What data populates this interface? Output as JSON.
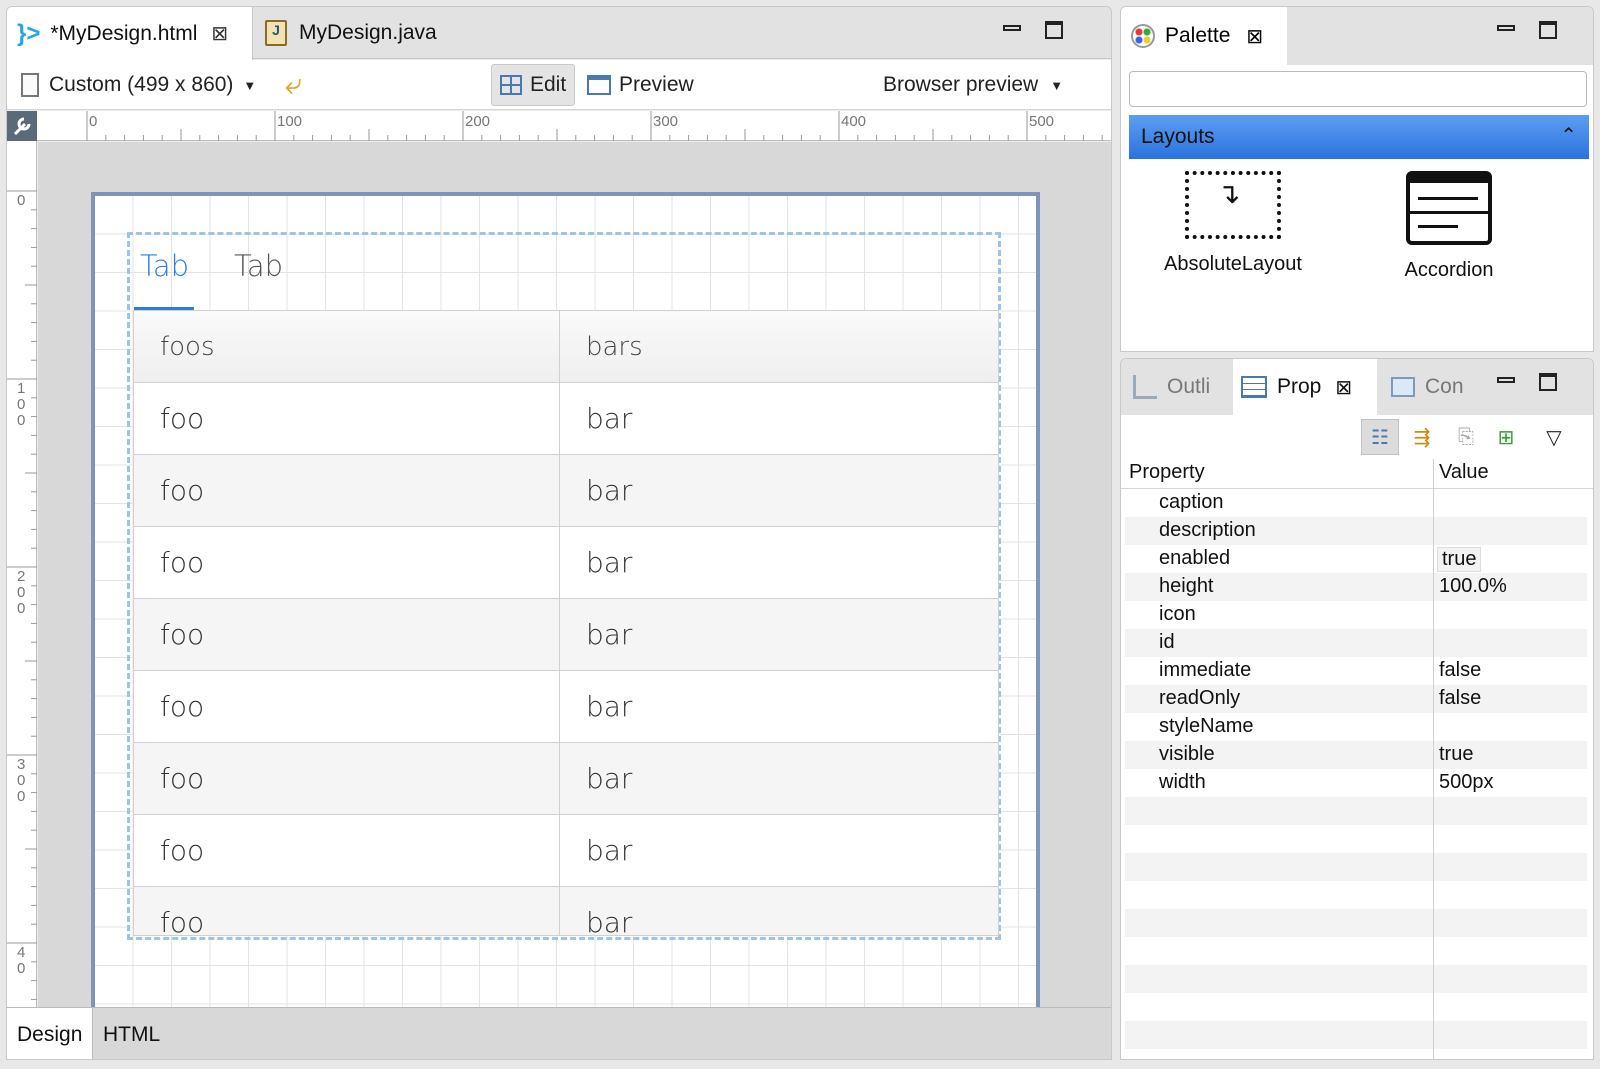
{
  "editor": {
    "tabs": [
      {
        "label": "*MyDesign.html",
        "active": true
      },
      {
        "label": "MyDesign.java",
        "active": false
      }
    ],
    "toolbar": {
      "size_select": "Custom (499 x 860)",
      "edit_label": "Edit",
      "preview_label": "Preview",
      "browser_preview": "Browser preview"
    },
    "ruler_h": [
      "0",
      "100",
      "200",
      "300",
      "400",
      "500"
    ],
    "ruler_v": [
      "0",
      "1\n0\n0",
      "2\n0\n0",
      "3\n0\n0",
      "4\n0"
    ],
    "design": {
      "tabs": [
        "Tab",
        "Tab"
      ],
      "grid_header": [
        "foos",
        "bars"
      ],
      "grid_rows": [
        [
          "foo",
          "bar"
        ],
        [
          "foo",
          "bar"
        ],
        [
          "foo",
          "bar"
        ],
        [
          "foo",
          "bar"
        ],
        [
          "foo",
          "bar"
        ],
        [
          "foo",
          "bar"
        ],
        [
          "foo",
          "bar"
        ],
        [
          "foo",
          "bar"
        ]
      ]
    },
    "bottom_tabs": [
      {
        "label": "Design",
        "active": true
      },
      {
        "label": "HTML",
        "active": false
      }
    ]
  },
  "palette": {
    "tab_label": "Palette",
    "search_placeholder": "",
    "category": "Layouts",
    "items": [
      "AbsoluteLayout",
      "Accordion"
    ]
  },
  "properties": {
    "tabs": [
      {
        "label": "Outli",
        "active": false
      },
      {
        "label": "Prop",
        "active": true
      },
      {
        "label": "Con",
        "active": false
      }
    ],
    "header": {
      "property": "Property",
      "value": "Value"
    },
    "rows": [
      {
        "key": "caption",
        "value": ""
      },
      {
        "key": "description",
        "value": ""
      },
      {
        "key": "enabled",
        "value": "true"
      },
      {
        "key": "height",
        "value": "100.0%"
      },
      {
        "key": "icon",
        "value": ""
      },
      {
        "key": "id",
        "value": ""
      },
      {
        "key": "immediate",
        "value": "false"
      },
      {
        "key": "readOnly",
        "value": "false"
      },
      {
        "key": "styleName",
        "value": ""
      },
      {
        "key": "visible",
        "value": "true"
      },
      {
        "key": "width",
        "value": "500px"
      }
    ]
  },
  "colors": {
    "accent": "#2c7fd3",
    "palette_header": "#2a73de",
    "design_border": "#7e94b8"
  }
}
